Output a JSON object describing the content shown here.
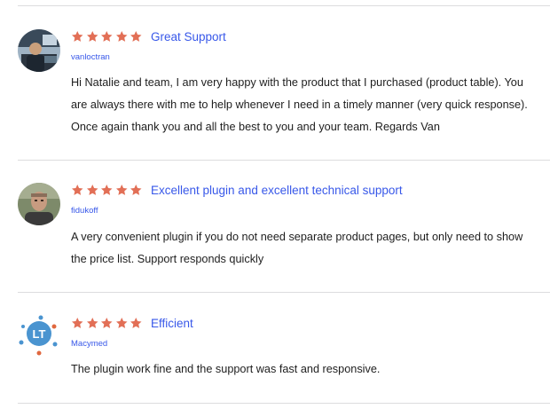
{
  "star_color": "#e26f56",
  "link_color": "#3858e9",
  "reviews": [
    {
      "rating": 5,
      "title": "Great Support",
      "author": "vanloctran",
      "avatar": "photo-avatar",
      "text": "Hi Natalie and team, I am very happy with the product that I purchased (product table). You are always there with me to help whenever I need in a timely manner (very quick response). Once again thank you and all the best to you and your team. Regards Van"
    },
    {
      "rating": 5,
      "title": "Excellent plugin and excellent technical support",
      "author": "fidukoff",
      "avatar": "photo-avatar",
      "text": "A very convenient plugin if you do not need separate product pages, but only need to show the price list. Support responds quickly"
    },
    {
      "rating": 5,
      "title": "Efficient",
      "author": "Macymed",
      "avatar": "logo-avatar",
      "avatar_text": "LT",
      "text": "The plugin work fine and the support was fast and responsive."
    }
  ]
}
